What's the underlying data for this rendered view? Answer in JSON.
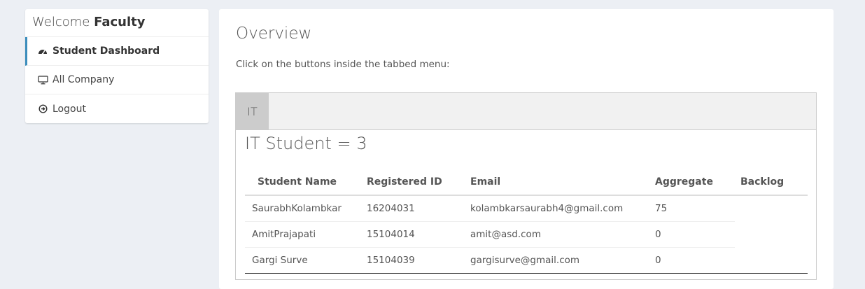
{
  "sidebar": {
    "welcome_prefix": "Welcome",
    "welcome_role": "Faculty",
    "items": [
      {
        "label": "Student Dashboard",
        "icon": "dashboard-icon"
      },
      {
        "label": "All Company",
        "icon": "monitor-icon"
      },
      {
        "label": "Logout",
        "icon": "logout-icon"
      }
    ]
  },
  "main": {
    "title": "Overview",
    "instruction": "Click on the buttons inside the tabbed menu:",
    "tabs": [
      {
        "label": "IT"
      }
    ],
    "count_label": "IT Student = 3",
    "table": {
      "headers": [
        "Student Name",
        "Registered ID",
        "Email",
        "Aggregate",
        "Backlog"
      ],
      "rows": [
        [
          "SaurabhKolambkar",
          "16204031",
          "kolambkarsaurabh4@gmail.com",
          "75",
          ""
        ],
        [
          "AmitPrajapati",
          "15104014",
          "amit@asd.com",
          "0",
          ""
        ],
        [
          "Gargi Surve",
          "15104039",
          "gargisurve@gmail.com",
          "0",
          ""
        ]
      ]
    }
  },
  "colors": {
    "accent": "#3c8dbc",
    "page_bg": "#eceff4",
    "tab_active": "#cccccc"
  }
}
